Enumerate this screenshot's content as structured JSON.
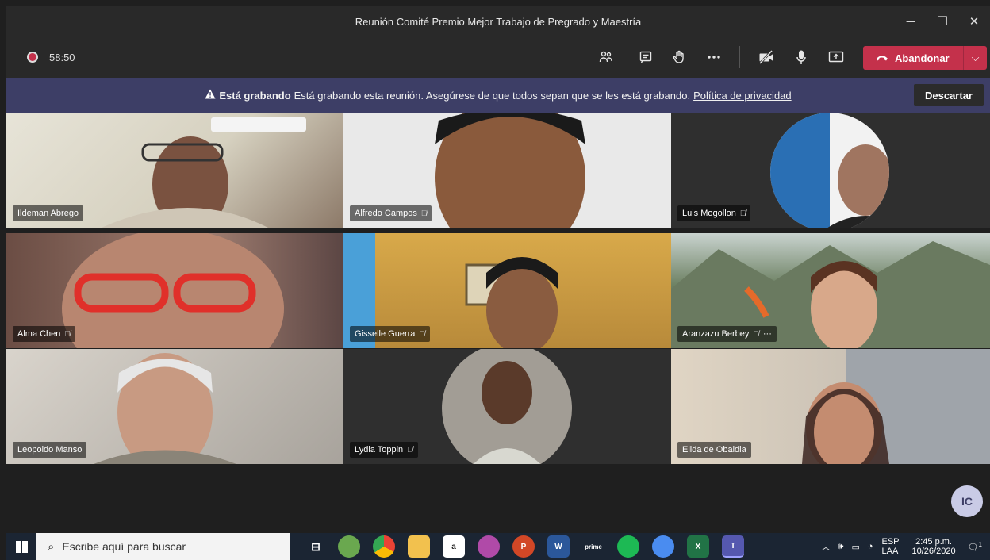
{
  "window": {
    "title": "Reunión Comité Premio Mejor Trabajo de Pregrado y Maestría",
    "controls": {
      "minimize": "─",
      "restore": "❐",
      "close": "✕"
    }
  },
  "toolbar": {
    "timer": "58:50",
    "leave_label": "Abandonar",
    "icons": {
      "participants": "people-icon",
      "chat": "chat-icon",
      "raise_hand": "hand-icon",
      "more": "more-icon",
      "camera": "camera-off-icon",
      "mic": "mic-icon",
      "share": "share-icon"
    }
  },
  "banner": {
    "title": "Está grabando",
    "message": "Está grabando esta reunión. Asegúrese de que todos sepan que se les está grabando.",
    "link": "Política de privacidad",
    "dismiss": "Descartar"
  },
  "participants": [
    {
      "name": "Ildeman Abrego",
      "muted": false
    },
    {
      "name": "Alfredo Campos",
      "muted": true
    },
    {
      "name": "Luis Mogollon",
      "muted": true
    },
    {
      "name": "Alma Chen",
      "muted": true
    },
    {
      "name": "Gisselle Guerra",
      "muted": true
    },
    {
      "name": "Aranzazu Berbey",
      "muted": true,
      "more": "···"
    },
    {
      "name": "Leopoldo Manso",
      "muted": false
    },
    {
      "name": "Lydia Toppin",
      "muted": true
    },
    {
      "name": "Elida de Obaldia",
      "muted": false
    }
  ],
  "self_avatar": "IC",
  "taskbar": {
    "search_placeholder": "Escribe aquí para buscar",
    "language_top": "ESP",
    "language_bottom": "LAA",
    "time": "2:45 p.m.",
    "date": "10/26/2020",
    "notification_count": "1"
  },
  "colors": {
    "accent": "#c4314b",
    "banner": "#3d3e66",
    "background": "#1f1f1f"
  }
}
